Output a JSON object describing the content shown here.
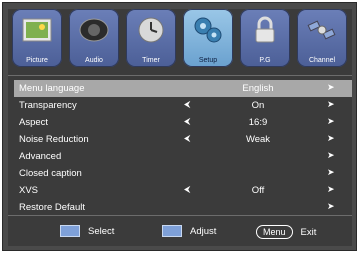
{
  "tabs": [
    {
      "label": "Picture",
      "icon": "picture-icon",
      "active": false
    },
    {
      "label": "Audio",
      "icon": "speaker-icon",
      "active": false
    },
    {
      "label": "Timer",
      "icon": "clock-icon",
      "active": false
    },
    {
      "label": "Setup",
      "icon": "gears-icon",
      "active": true
    },
    {
      "label": "P.G",
      "icon": "lock-icon",
      "active": false
    },
    {
      "label": "Channel",
      "icon": "satellite-icon",
      "active": false
    }
  ],
  "menu": [
    {
      "name": "Menu language",
      "value": "English",
      "left_arrow": "",
      "right_arrow": "➤",
      "selected": true
    },
    {
      "name": "Transparency",
      "value": "On",
      "left_arrow": "⮜",
      "right_arrow": "➤",
      "selected": false
    },
    {
      "name": "Aspect",
      "value": "16:9",
      "left_arrow": "⮜",
      "right_arrow": "➤",
      "selected": false
    },
    {
      "name": "Noise  Reduction",
      "value": "Weak",
      "left_arrow": "⮜",
      "right_arrow": "➤",
      "selected": false
    },
    {
      "name": "Advanced",
      "value": "",
      "left_arrow": "",
      "right_arrow": "➤",
      "selected": false
    },
    {
      "name": "Closed caption",
      "value": "",
      "left_arrow": "",
      "right_arrow": "➤",
      "selected": false
    },
    {
      "name": "XVS",
      "value": "Off",
      "left_arrow": "⮜",
      "right_arrow": "➤",
      "selected": false
    },
    {
      "name": "Restore Default",
      "value": "",
      "left_arrow": "",
      "right_arrow": "➤",
      "selected": false
    }
  ],
  "footer": {
    "select_label": "Select",
    "adjust_label": "Adjust",
    "menu_button": "Menu",
    "exit_label": "Exit"
  },
  "colors": {
    "selected_row": "#a8a8a8",
    "active_tab": "#8fbfe3",
    "panel": "#3b3b3b"
  }
}
